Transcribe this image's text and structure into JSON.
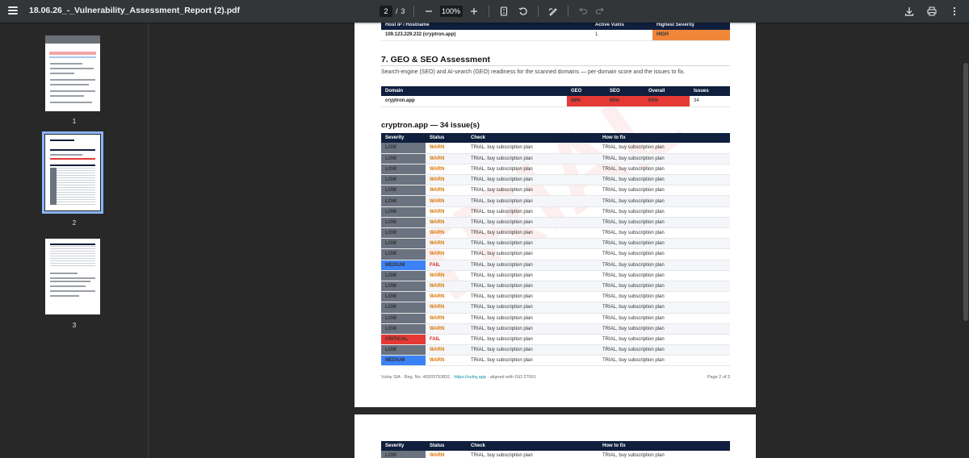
{
  "toolbar": {
    "file_name": "18.06.26_-_Vulnerability_Assessment_Report (2).pdf",
    "current_page": "2",
    "page_separator": "/",
    "total_pages": "3",
    "zoom": "100%"
  },
  "sidebar": {
    "thumbnails": [
      {
        "label": "1"
      },
      {
        "label": "2"
      },
      {
        "label": "3"
      }
    ]
  },
  "hosts_table": {
    "headers": [
      "Host IP / Hostname",
      "Active Vulns",
      "Highest Severity"
    ],
    "rows": [
      {
        "host": "109.123.229.232 (cryptron.app)",
        "vulns": "1",
        "severity": "HIGH"
      }
    ]
  },
  "geo_section": {
    "title": "7. GEO & SEO Assessment",
    "description": "Search-engine (SEO) and AI-search (GEO) readiness for the scanned domains — per-domain score and the issues to fix.",
    "headers": [
      "Domain",
      "GEO",
      "SEO",
      "Overall",
      "Issues"
    ],
    "rows": [
      {
        "domain": "cryptron.app",
        "geo": "58%",
        "seo": "66%",
        "overall": "63%",
        "issues": "34"
      }
    ]
  },
  "issues_section": {
    "title": "cryptron.app — 34 issue(s)",
    "headers": [
      "Severity",
      "Status",
      "Check",
      "How to fix"
    ],
    "rows": [
      {
        "severity": "LOW",
        "status": "WARN",
        "check": "TRIAL, buy subscription plan",
        "fix": "TRIAL, buy subscription plan"
      },
      {
        "severity": "LOW",
        "status": "WARN",
        "check": "TRIAL, buy subscription plan",
        "fix": "TRIAL, buy subscription plan"
      },
      {
        "severity": "LOW",
        "status": "WARN",
        "check": "TRIAL, buy subscription plan",
        "fix": "TRIAL, buy subscription plan"
      },
      {
        "severity": "LOW",
        "status": "WARN",
        "check": "TRIAL, buy subscription plan",
        "fix": "TRIAL, buy subscription plan"
      },
      {
        "severity": "LOW",
        "status": "WARN",
        "check": "TRIAL, buy subscription plan",
        "fix": "TRIAL, buy subscription plan"
      },
      {
        "severity": "LOW",
        "status": "WARN",
        "check": "TRIAL, buy subscription plan",
        "fix": "TRIAL, buy subscription plan"
      },
      {
        "severity": "LOW",
        "status": "WARN",
        "check": "TRIAL, buy subscription plan",
        "fix": "TRIAL, buy subscription plan"
      },
      {
        "severity": "LOW",
        "status": "WARN",
        "check": "TRIAL, buy subscription plan",
        "fix": "TRIAL, buy subscription plan"
      },
      {
        "severity": "LOW",
        "status": "WARN",
        "check": "TRIAL, buy subscription plan",
        "fix": "TRIAL, buy subscription plan"
      },
      {
        "severity": "LOW",
        "status": "WARN",
        "check": "TRIAL, buy subscription plan",
        "fix": "TRIAL, buy subscription plan"
      },
      {
        "severity": "LOW",
        "status": "WARN",
        "check": "TRIAL, buy subscription plan",
        "fix": "TRIAL, buy subscription plan"
      },
      {
        "severity": "MEDIUM",
        "status": "FAIL",
        "check": "TRIAL, buy subscription plan",
        "fix": "TRIAL, buy subscription plan"
      },
      {
        "severity": "LOW",
        "status": "WARN",
        "check": "TRIAL, buy subscription plan",
        "fix": "TRIAL, buy subscription plan"
      },
      {
        "severity": "LOW",
        "status": "WARN",
        "check": "TRIAL, buy subscription plan",
        "fix": "TRIAL, buy subscription plan"
      },
      {
        "severity": "LOW",
        "status": "WARN",
        "check": "TRIAL, buy subscription plan",
        "fix": "TRIAL, buy subscription plan"
      },
      {
        "severity": "LOW",
        "status": "WARN",
        "check": "TRIAL, buy subscription plan",
        "fix": "TRIAL, buy subscription plan"
      },
      {
        "severity": "LOW",
        "status": "WARN",
        "check": "TRIAL, buy subscription plan",
        "fix": "TRIAL, buy subscription plan"
      },
      {
        "severity": "LOW",
        "status": "WARN",
        "check": "TRIAL, buy subscription plan",
        "fix": "TRIAL, buy subscription plan"
      },
      {
        "severity": "CRITICAL",
        "status": "FAIL",
        "check": "TRIAL, buy subscription plan",
        "fix": "TRIAL, buy subscription plan"
      },
      {
        "severity": "LOW",
        "status": "WARN",
        "check": "TRIAL, buy subscription plan",
        "fix": "TRIAL, buy subscription plan"
      },
      {
        "severity": "MEDIUM",
        "status": "WARN",
        "check": "TRIAL, buy subscription plan",
        "fix": "TRIAL, buy subscription plan"
      }
    ]
  },
  "footer": {
    "company": "Vulny SIA · Reg. No. 40203753831 · ",
    "link": "https://vulny.app",
    "suffix": " · aligned with ISO 27001",
    "page": "Page 2 of 3"
  },
  "next_page": {
    "headers": [
      "Severity",
      "Status",
      "Check",
      "How to fix"
    ],
    "first_row": {
      "severity": "LOW",
      "status": "WARN",
      "check": "TRIAL, buy subscription plan",
      "fix": "TRIAL, buy subscription plan"
    }
  },
  "colors": {
    "header_navy": "#0f1f3d",
    "low": "#6b7280",
    "medium": "#3b82f6",
    "critical": "#e53935",
    "high": "#f0863a",
    "warn": "#d97706",
    "fail": "#dc2626"
  }
}
